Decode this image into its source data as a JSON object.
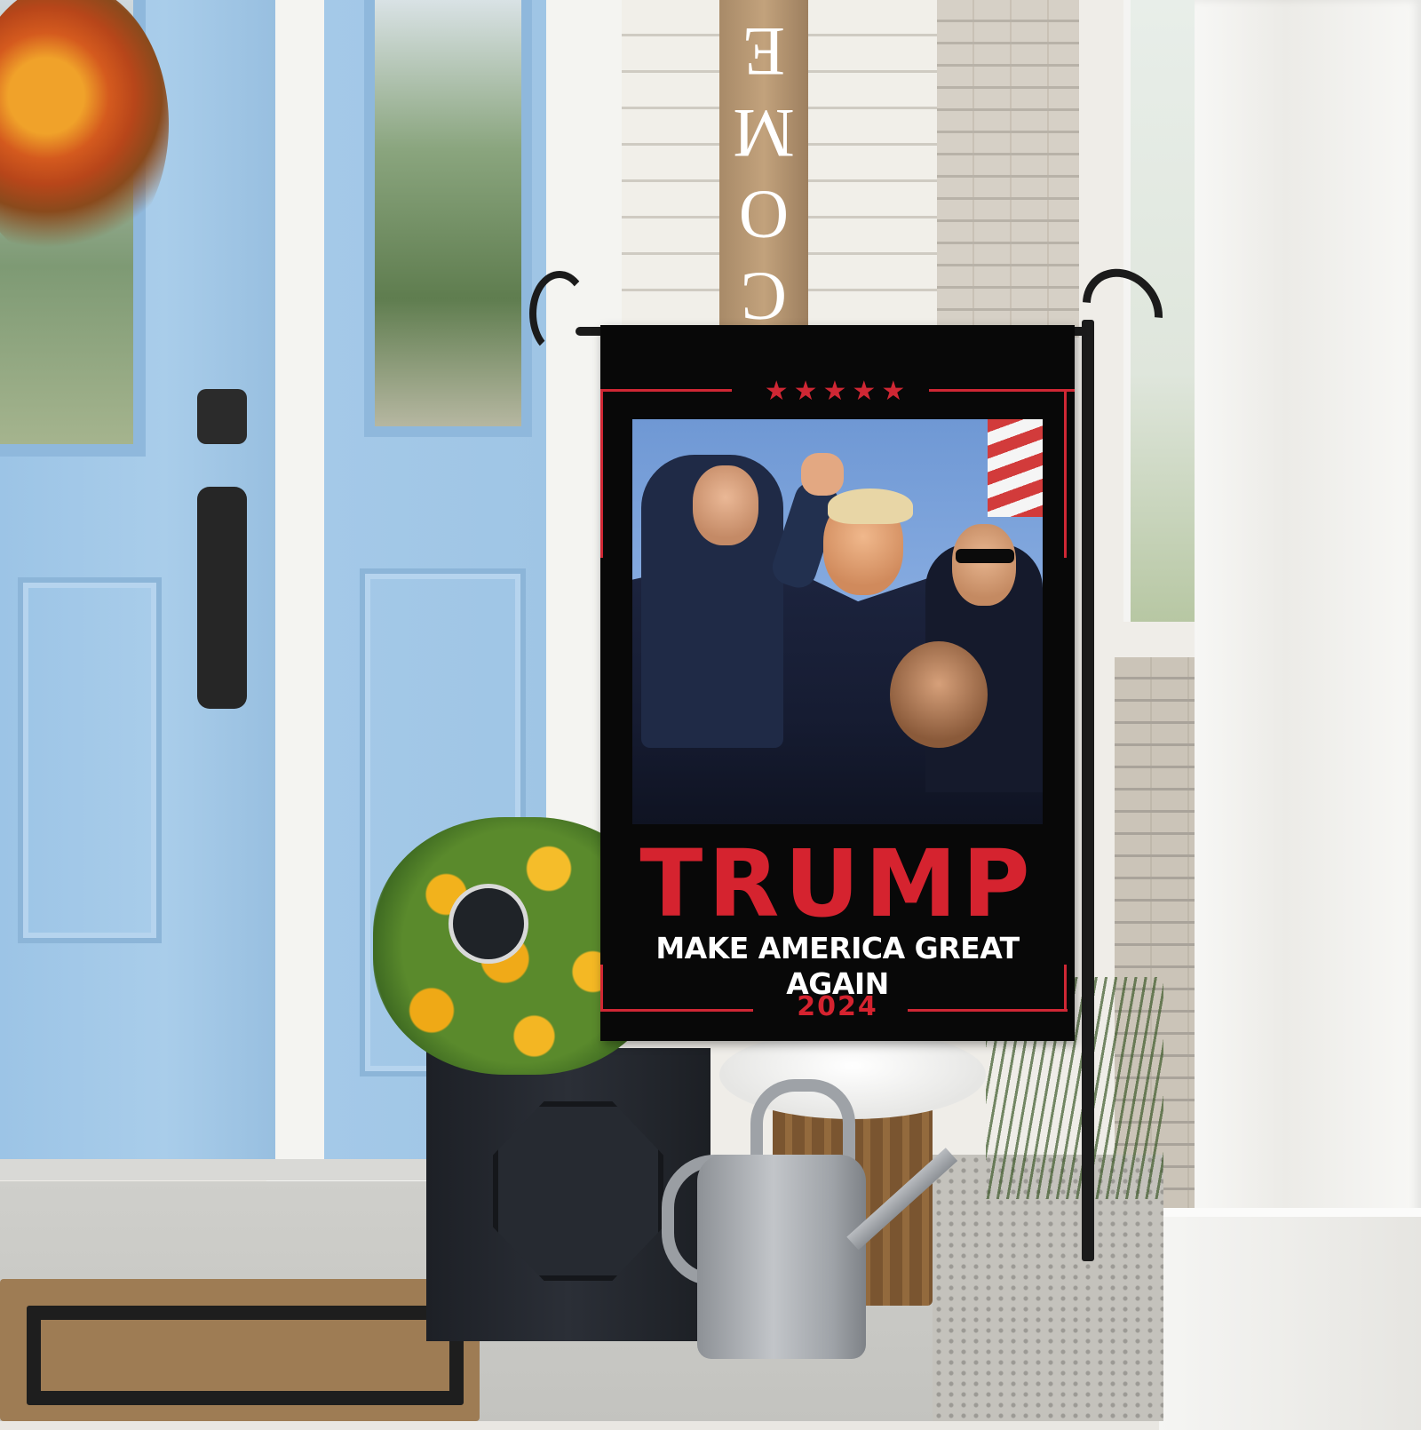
{
  "welcome_sign": {
    "letters": [
      "C",
      "O",
      "M",
      "E"
    ]
  },
  "flag": {
    "stars": "★★★★★",
    "title": "TRUMP",
    "slogan": "MAKE AMERICA GREAT AGAIN",
    "year": "2024"
  },
  "colors": {
    "flag_background": "#080808",
    "accent_red": "#d5232f",
    "slogan_text": "#ffffff",
    "door_blue": "#a9cdea"
  }
}
